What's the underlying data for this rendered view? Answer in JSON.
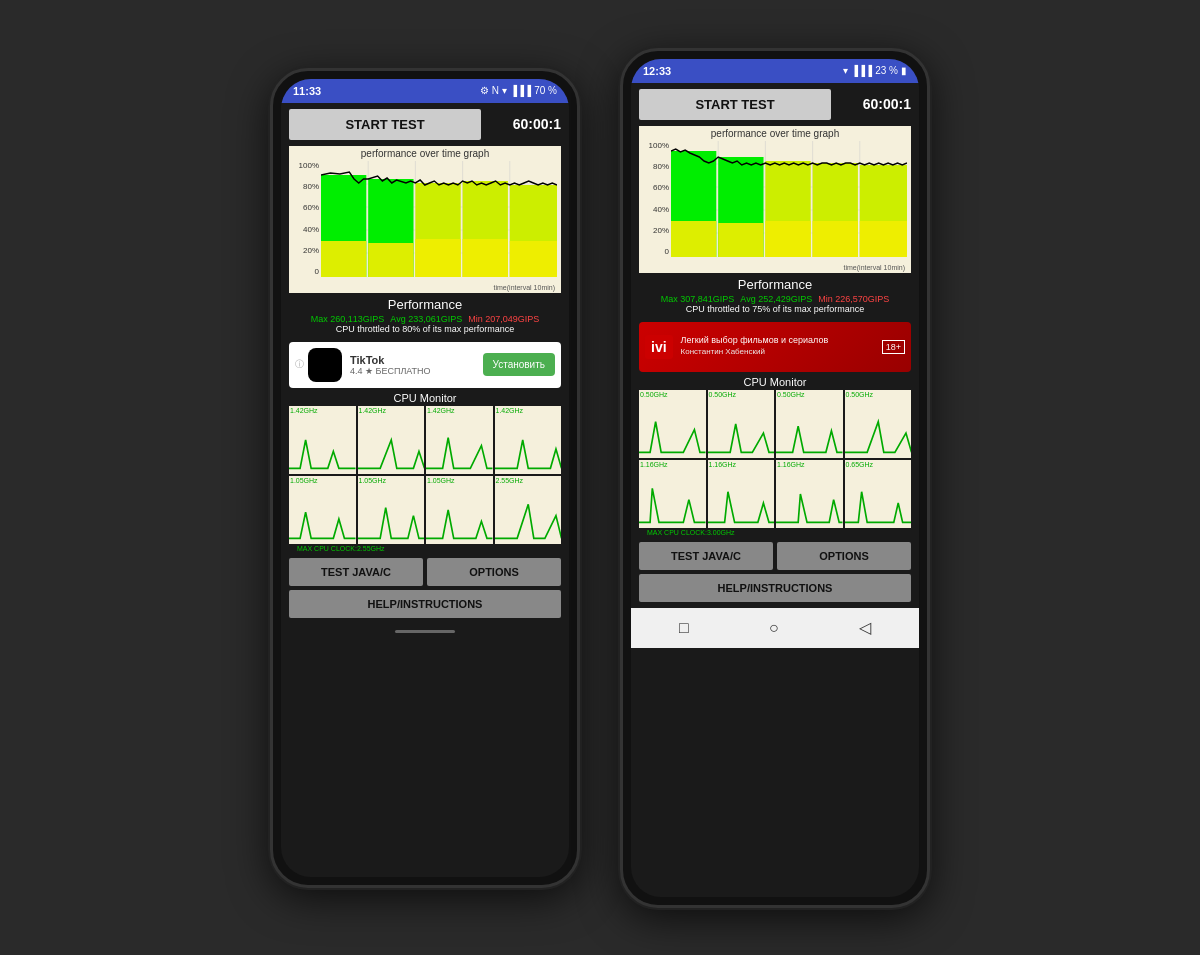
{
  "background_color": "#2a2a2a",
  "phones": [
    {
      "id": "phone1",
      "status_bar": {
        "time": "11:33",
        "battery": "70 %",
        "icons": "⚙ □ 🖼 ▶"
      },
      "top_bar": {
        "start_test_label": "START TEST",
        "timer": "60:00:1"
      },
      "graph": {
        "title": "performance over time graph",
        "y_labels": [
          "100%",
          "80%",
          "60%",
          "40%",
          "20%",
          "0"
        ],
        "time_label": "time(interval 10min)"
      },
      "performance": {
        "title": "Performance",
        "max": "Max 260,113GIPS",
        "avg": "Avg 233,061GIPS",
        "min": "Min 207,049GIPS",
        "throttle": "CPU throttled to 80% of its max performance"
      },
      "ad": {
        "type": "tiktok",
        "name": "TikTok",
        "rating": "4.4 ★  БЕСПЛАТНО",
        "install_label": "Установить"
      },
      "cpu_monitor": {
        "title": "CPU Monitor",
        "cores": [
          {
            "label": "1.42GHz",
            "row": 0
          },
          {
            "label": "1.42GHz",
            "row": 0
          },
          {
            "label": "1.42GHz",
            "row": 0
          },
          {
            "label": "1.42GHz",
            "row": 0
          },
          {
            "label": "1.05GHz",
            "row": 1
          },
          {
            "label": "1.05GHz",
            "row": 1
          },
          {
            "label": "1.05GHz",
            "row": 1
          },
          {
            "label": "2.55GHz",
            "row": 1
          }
        ],
        "max_cpu": "MAX CPU CLOCK:2.55GHz"
      },
      "buttons": {
        "test_java": "TEST JAVA/C",
        "options": "OPTIONS",
        "help": "HELP/INSTRUCTIONS"
      },
      "has_nav_bar": false
    },
    {
      "id": "phone2",
      "status_bar": {
        "time": "12:33",
        "battery": "23 %",
        "icons": "▼ □ □ □"
      },
      "top_bar": {
        "start_test_label": "START TEST",
        "timer": "60:00:1"
      },
      "graph": {
        "title": "performance over time graph",
        "y_labels": [
          "100%",
          "80%",
          "60%",
          "40%",
          "20%",
          "0"
        ],
        "time_label": "time(interval 10min)"
      },
      "performance": {
        "title": "Performance",
        "max": "Max 307,841GIPS",
        "avg": "Avg 252,429GIPS",
        "min": "Min 226,570GIPS",
        "throttle": "CPU throttled to 75% of its max performance"
      },
      "ad": {
        "type": "ivi",
        "logo": "ivi",
        "text": "Легкий выбор фильмов и сериалов",
        "person": "Константин Хабенский",
        "age": "18+"
      },
      "cpu_monitor": {
        "title": "CPU Monitor",
        "cores": [
          {
            "label": "0.50GHz",
            "row": 0
          },
          {
            "label": "0.50GHz",
            "row": 0
          },
          {
            "label": "0.50GHz",
            "row": 0
          },
          {
            "label": "0.50GHz",
            "row": 0
          },
          {
            "label": "1.16GHz",
            "row": 1
          },
          {
            "label": "1.16GHz",
            "row": 1
          },
          {
            "label": "1.16GHz",
            "row": 1
          },
          {
            "label": "0.65GHz",
            "row": 1
          }
        ],
        "max_cpu": "MAX CPU CLOCK:3.00GHz"
      },
      "buttons": {
        "test_java": "TEST JAVA/C",
        "options": "OPTIONS",
        "help": "HELP/INSTRUCTIONS"
      },
      "has_nav_bar": true
    }
  ]
}
